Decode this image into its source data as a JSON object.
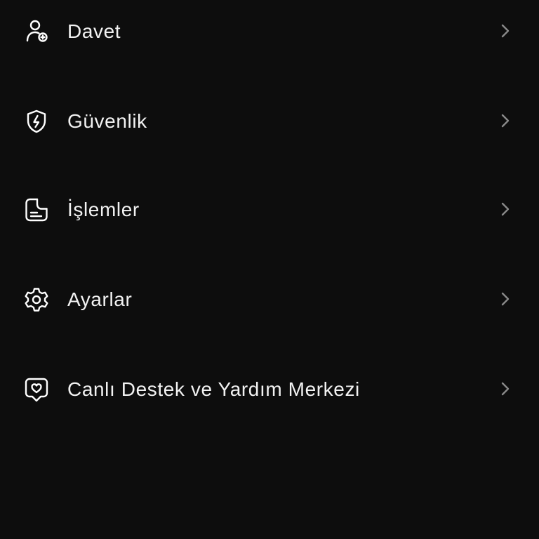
{
  "menu": {
    "items": [
      {
        "label": "Davet",
        "icon": "user-plus-icon"
      },
      {
        "label": "Güvenlik",
        "icon": "shield-bolt-icon"
      },
      {
        "label": "İşlemler",
        "icon": "document-icon"
      },
      {
        "label": "Ayarlar",
        "icon": "gear-icon"
      },
      {
        "label": "Canlı Destek ve Yardım Merkezi",
        "icon": "heart-badge-icon"
      }
    ]
  },
  "colors": {
    "background": "#0d0d0d",
    "text": "#f2f2f2",
    "icon": "#ffffff",
    "chevron": "#8a8a8a"
  }
}
